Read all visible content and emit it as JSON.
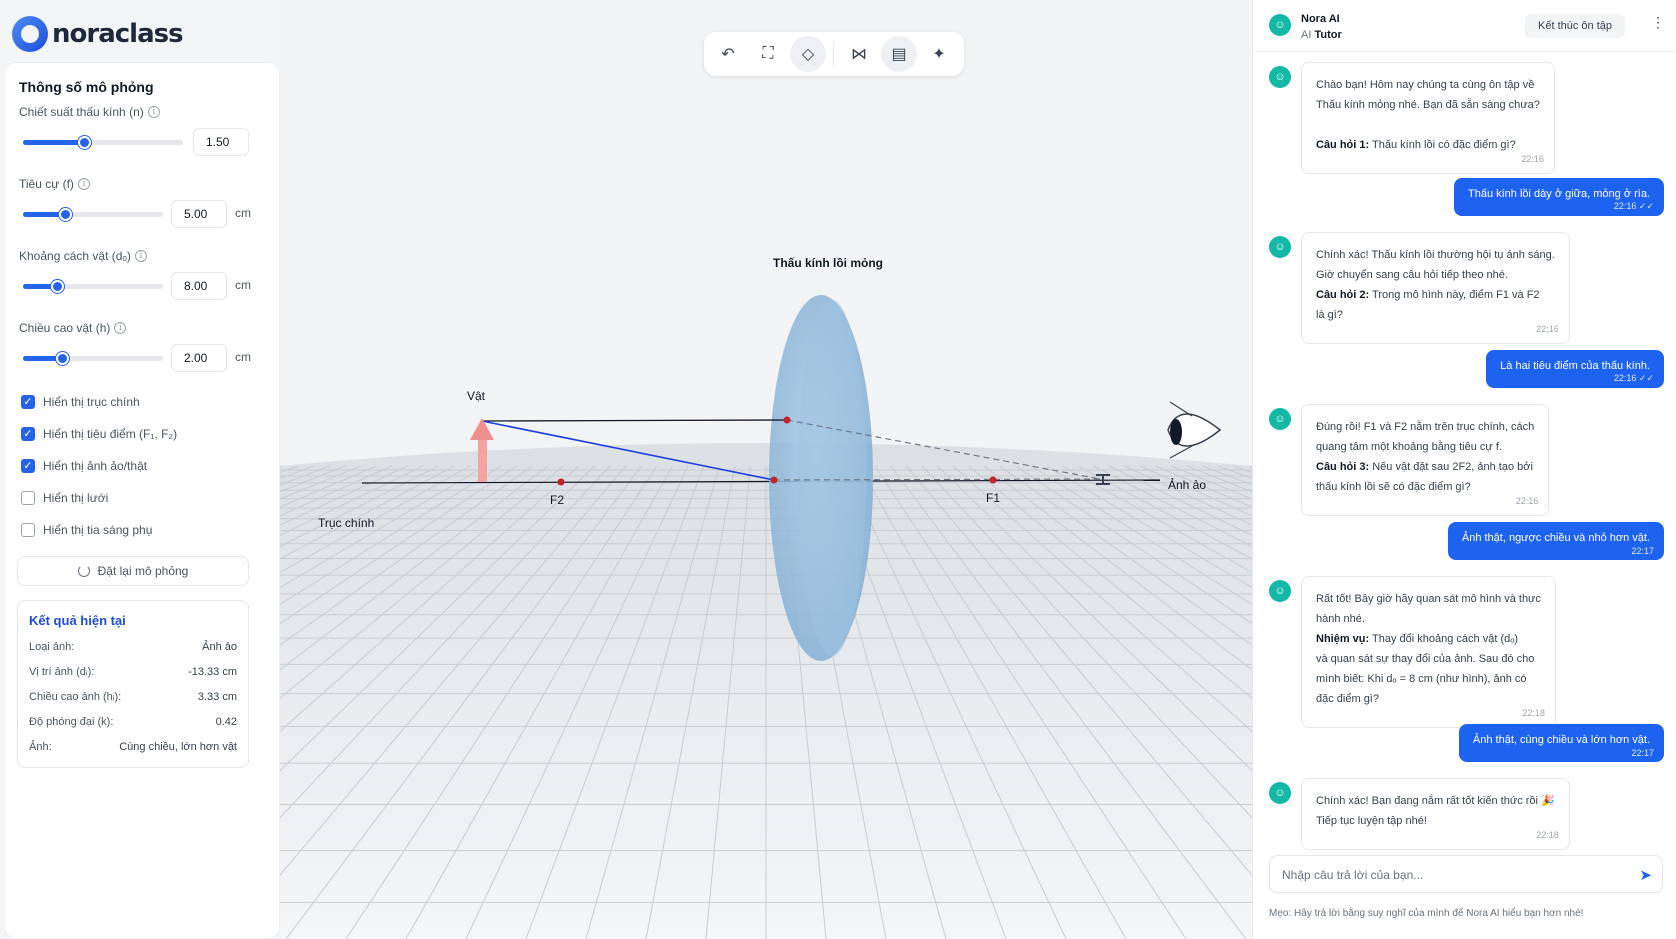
{
  "brand": {
    "name": "noraclass"
  },
  "params": {
    "title": "Thông số mô phỏng",
    "refractive_index": {
      "label": "Chiết suất thấu kính (n)",
      "value": "1.50",
      "slider_fraction": 0.38
    },
    "focal_length": {
      "label": "Tiêu cự (f)",
      "value": "5.00",
      "unit": "cm",
      "slider_fraction": 0.3
    },
    "object_distance": {
      "label": "Khoảng cách vật (dₒ)",
      "value": "8.00",
      "unit": "cm",
      "slider_fraction": 0.24
    },
    "object_height": {
      "label": "Chiều cao vật (h)",
      "value": "2.00",
      "unit": "cm",
      "slider_fraction": 0.28
    },
    "checkboxes": [
      {
        "label": "Hiển thị trục chính",
        "checked": true
      },
      {
        "label": "Hiển thị tiêu điểm (F₁, F₂)",
        "checked": true
      },
      {
        "label": "Hiển thị ảnh ảo/thật",
        "checked": true
      },
      {
        "label": "Hiển thị lưới",
        "checked": false
      },
      {
        "label": "Hiển thị tia sáng phụ",
        "checked": false
      }
    ],
    "reset_label": "Đặt lại mô phỏng"
  },
  "result": {
    "title": "Kết quả hiện tại",
    "rows": [
      {
        "label": "Loại ảnh:",
        "value": "Ảnh ảo"
      },
      {
        "label": "Vị trí ảnh (dᵢ):",
        "value": "-13.33 cm"
      },
      {
        "label": "Chiều cao ảnh (hᵢ):",
        "value": "3.33 cm"
      },
      {
        "label": "Độ phóng đại (k):",
        "value": "0.42"
      },
      {
        "label": "Ảnh:",
        "value": "Cùng chiều, lớn hơn vật"
      }
    ]
  },
  "toolbar": {
    "icons": [
      "undo-icon",
      "fullscreen-icon",
      "tag-icon",
      "share-icon",
      "notes-icon",
      "sparkle-icon"
    ]
  },
  "scene": {
    "lens_label": "Thấu kính lồi mỏng",
    "object_label": "Vật",
    "image_label": "Ảnh ảo",
    "f1_label": "F1",
    "f2_label": "F2",
    "axis_label": "Trục chính"
  },
  "chat": {
    "bot_name": "Nora AI",
    "bot_role_prefix": "AI",
    "bot_role": "Tutor",
    "end_button": "Kết thúc ôn tập",
    "messages": [
      {
        "from": "bot",
        "lines": [
          "Chào bạn! Hôm nay chúng ta cùng ôn tập về",
          "Thấu kính mỏng nhé. Bạn đã sẵn sàng chưa?",
          "",
          "Câu hỏi 1: Thấu kính lồi có đặc điểm gì?"
        ],
        "time": "22:16"
      },
      {
        "from": "user",
        "text": "Thấu kính lồi dày ở giữa, mỏng ở rìa.",
        "time": "22:16 ✓✓"
      },
      {
        "from": "bot",
        "lines": [
          "Chính xác! Thấu kính lồi thường hội tụ ánh sáng.",
          "Giờ chuyển sang câu hỏi tiếp theo nhé.",
          "Câu hỏi 2: Trong mô hình này, điểm F1 và F2",
          "là gì?"
        ],
        "time": "22:16"
      },
      {
        "from": "user",
        "text": "Là hai tiêu điểm của thấu kính.",
        "time": "22:16 ✓✓"
      },
      {
        "from": "bot",
        "lines": [
          "Đúng rồi! F1 và F2 nằm trên trục chính, cách",
          "quang tâm một khoảng bằng tiêu cự f.",
          "Câu hỏi 3: Nếu vật đặt sau 2F2, ảnh tạo bởi",
          "thấu kính lồi sẽ có đặc điểm gì?"
        ],
        "time": "22:16"
      },
      {
        "from": "user",
        "text": "Ảnh thật, ngược chiều và nhỏ hơn vật.",
        "time": "22:17"
      },
      {
        "from": "bot",
        "lines": [
          "Rất tốt! Bây giờ hãy quan sát mô hình và thực",
          "hành nhé.",
          "Nhiệm vụ: Thay đổi khoảng cách vật (dₒ)",
          "và quan sát sự thay đổi của ảnh. Sau đó cho",
          "mình biết: Khi dₒ = 8 cm (như hình), ảnh có",
          "đặc điểm gì?"
        ],
        "time": "22:18"
      },
      {
        "from": "user",
        "text": "Ảnh thật, cùng chiều và lớn hơn vật.",
        "time": "22:17"
      },
      {
        "from": "bot",
        "lines": [
          "Chính xác! Bạn đang nắm rất tốt kiến thức rồi 🎉",
          "Tiếp tục luyện tập nhé!"
        ],
        "time": "22:18"
      }
    ],
    "bold_prefixes": [
      "Câu hỏi 1:",
      "Câu hỏi 2:",
      "Câu hỏi 3:",
      "Nhiệm vụ:"
    ],
    "input_placeholder": "Nhập câu trả lời của bạn...",
    "hint": "Mẹo: Hãy trả lời bằng suy nghĩ của mình để Nora AI hiểu bạn hơn nhé!"
  },
  "colors": {
    "accent": "#2563eb",
    "user_bubble": "#1d63f0",
    "bot_avatar": "#14b8a6",
    "lens": "#8bb8dc",
    "object_arrow": "#f08f8f"
  }
}
